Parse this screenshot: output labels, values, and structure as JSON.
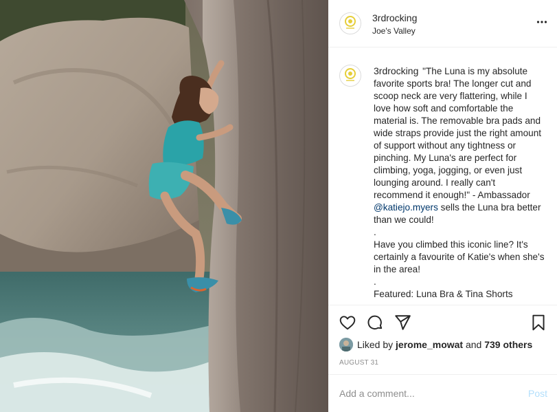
{
  "post": {
    "username": "3rdrocking",
    "location": "Joe's Valley",
    "more_icon": "more-horizontal-icon",
    "avatar_text": "3RD ROCK"
  },
  "caption": {
    "username": "3rdrocking",
    "text_1": "\"The Luna is my absolute favorite sports bra! The longer cut and scoop neck are very flattering, while I love how soft and comfortable the material is. The removable bra pads and wide straps provide just the right amount of support without any tightness or pinching. My Luna's are perfect for climbing, yoga, jogging, or even just lounging around. I really can't recommend it enough!\" - Ambassador",
    "mention": "@katiejo.myers",
    "text_2": "sells the Luna bra better than we could!",
    "dot_1": ".",
    "para_2": "Have you climbed this iconic line? It's certainly a favourite of Katie's when she's in the area!",
    "dot_2": ".",
    "para_3": "Featured: Luna Bra & Tina Shorts"
  },
  "actions": {
    "like_icon": "heart-icon",
    "comment_icon": "comment-icon",
    "share_icon": "paper-plane-icon",
    "save_icon": "bookmark-icon"
  },
  "likes": {
    "prefix": "Liked by",
    "user": "jerome_mowat",
    "conjunction": "and",
    "others": "739 others"
  },
  "date": "AUGUST 31",
  "comment": {
    "placeholder": "Add a comment...",
    "post_label": "Post"
  },
  "colors": {
    "text": "#262626",
    "secondary": "#8e8e8e",
    "link": "#00376b",
    "post_disabled": "#b2dffc",
    "divider": "#efefef"
  }
}
